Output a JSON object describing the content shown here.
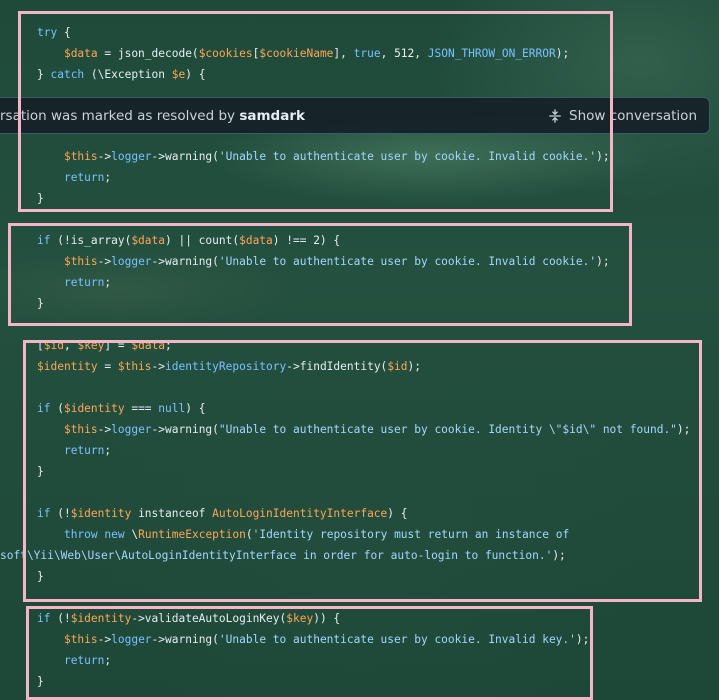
{
  "resolved_bar": {
    "text_prefix": "rsation was marked as resolved by",
    "user": "samdark",
    "show_conversation_label": "Show conversation"
  },
  "code": {
    "block1": {
      "l1": [
        "try",
        " {"
      ],
      "l2": [
        "    ",
        "$data",
        " = json_decode(",
        "$cookies",
        "[",
        "$cookieName",
        "], ",
        "true",
        ", 512, ",
        "JSON_THROW_ON_ERROR",
        ");"
      ],
      "l3": [
        "} ",
        "catch",
        " (\\Exception ",
        "$e",
        ") {"
      ],
      "l4": [
        "    ",
        "$this",
        "->",
        "logger",
        "->warning(",
        "'Unable to authenticate user by cookie. Invalid cookie.'",
        ");"
      ],
      "l5": [
        "    ",
        "return",
        ";"
      ],
      "l6": [
        "}"
      ]
    },
    "block2": {
      "l1": [
        "if",
        " (!is_array(",
        "$data",
        ") || count(",
        "$data",
        ") !== 2) {"
      ],
      "l2": [
        "    ",
        "$this",
        "->",
        "logger",
        "->warning(",
        "'Unable to authenticate user by cookie. Invalid cookie.'",
        ");"
      ],
      "l3": [
        "    ",
        "return",
        ";"
      ],
      "l4": [
        "}"
      ]
    },
    "block3": {
      "l0": [
        "[",
        "$id",
        ", ",
        "$key",
        "] = ",
        "$data",
        ";"
      ],
      "l1": [
        "$identity",
        " = ",
        "$this",
        "->",
        "identityRepository",
        "->findIdentity(",
        "$id",
        ");"
      ],
      "l2": [
        "if",
        " (",
        "$identity",
        " === ",
        "null",
        ") {"
      ],
      "l3": [
        "    ",
        "$this",
        "->",
        "logger",
        "->warning(",
        "\"Unable to authenticate user by cookie. Identity \\\"$id\\\" not found.\"",
        ");"
      ],
      "l4": [
        "    ",
        "return",
        ";"
      ],
      "l5": [
        "}"
      ],
      "l6": [
        "if",
        " (!",
        "$identity",
        " instanceof ",
        "AutoLoginIdentityInterface",
        ") {"
      ],
      "l7": [
        "    ",
        "throw",
        " ",
        "new",
        " \\",
        "RuntimeException",
        "(",
        "'Identity repository must return an instance of"
      ],
      "l8": [
        "soft\\Yii\\Web\\User\\AutoLoginIdentityInterface in order for auto-login to function.'",
        ");"
      ],
      "l9": [
        "}"
      ]
    },
    "block4": {
      "l1": [
        "if",
        " (!",
        "$identity",
        "->validateAutoLoginKey(",
        "$key",
        ")) {"
      ],
      "l2": [
        "    ",
        "$this",
        "->",
        "logger",
        "->warning(",
        "'Unable to authenticate user by cookie. Invalid key.'",
        ");"
      ],
      "l3": [
        "    ",
        "return",
        ";"
      ],
      "l4": [
        "}"
      ]
    }
  }
}
